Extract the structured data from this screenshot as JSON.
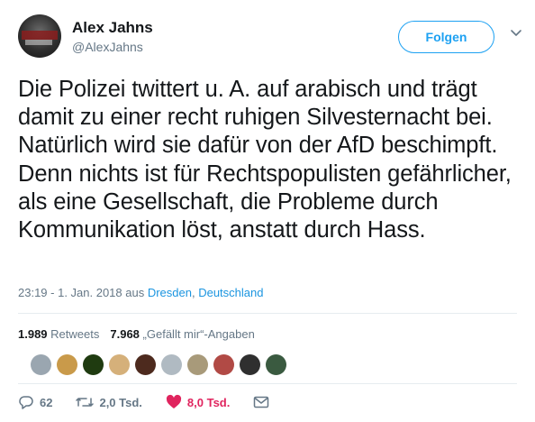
{
  "author": {
    "name": "Alex Jahns",
    "handle": "@AlexJahns",
    "follow_label": "Folgen"
  },
  "tweet": {
    "text": "Die Polizei twittert u. A. auf arabisch und trägt damit zu einer recht ruhigen Silvesternacht bei. Natürlich wird sie dafür von der AfD beschimpft. Denn nichts ist für Rechtspopulisten gefährlicher, als eine Gesellschaft, die Probleme durch Kommunikation löst, anstatt durch Hass.",
    "timestamp": "23:19 - 1. Jan. 2018 aus ",
    "location_city": "Dresden",
    "location_separator": ", ",
    "location_country": "Deutschland"
  },
  "stats": {
    "retweets_count": "1.989",
    "retweets_label": "Retweets",
    "likes_count": "7.968",
    "likes_label": "„Gefällt mir“-Angaben"
  },
  "liker_avatars": [
    {
      "color": "#9aa6b0"
    },
    {
      "color": "#c99a4a"
    },
    {
      "color": "#1f3b10"
    },
    {
      "color": "#d5b07a"
    },
    {
      "color": "#4d2a1e"
    },
    {
      "color": "#b0bac2"
    },
    {
      "color": "#a89a7a"
    },
    {
      "color": "#b14a45"
    },
    {
      "color": "#2f2f2f"
    },
    {
      "color": "#3a5a40"
    }
  ],
  "actions": {
    "replies": "62",
    "retweets": "2,0 Tsd.",
    "likes": "8,0 Tsd."
  },
  "colors": {
    "accent": "#1da1f2",
    "link": "#1b95e0",
    "like": "#e0245e",
    "muted": "#657786"
  }
}
